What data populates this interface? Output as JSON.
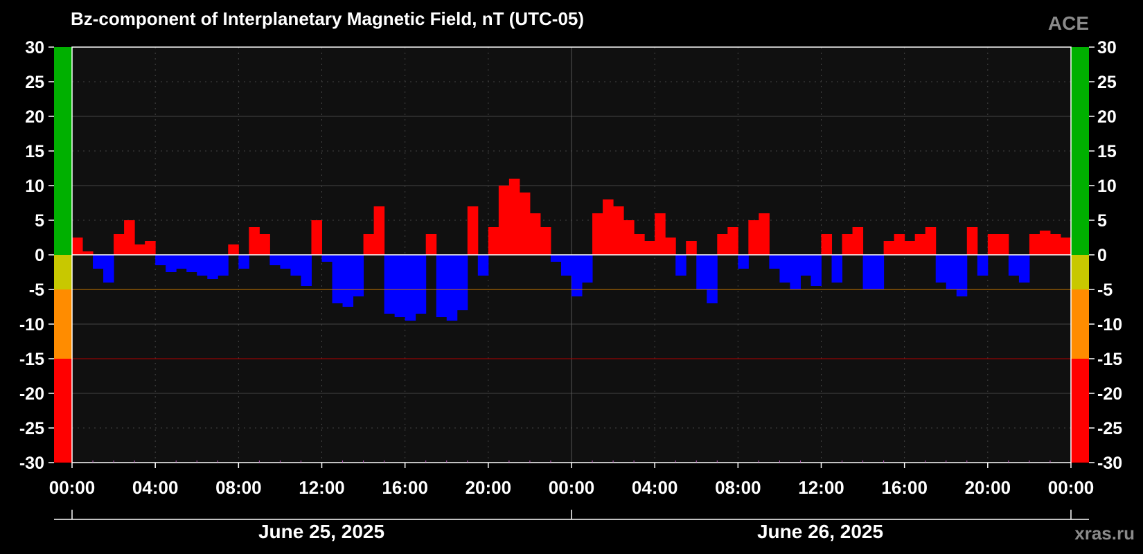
{
  "title": "Bz-component of Interplanetary Magnetic Field, nT (UTC-05)",
  "source_label": "ACE",
  "credit": "xras.ru",
  "dates": [
    "June 25, 2025",
    "June 26, 2025"
  ],
  "colors": {
    "positive": "#ff0000",
    "negative": "#0000ff",
    "plot_background": "#101010",
    "zone_green": "#00b000",
    "zone_yellow": "#c8c800",
    "zone_orange": "#ff8c00",
    "zone_red": "#ff0000"
  },
  "chart_data": {
    "type": "bar",
    "title": "Bz-component of Interplanetary Magnetic Field, nT (UTC-05)",
    "xlabel": "",
    "ylabel": "",
    "ylim": [
      -30,
      30
    ],
    "yticks": [
      30,
      25,
      20,
      15,
      10,
      5,
      0,
      -5,
      -10,
      -15,
      -20,
      -25,
      -30
    ],
    "xlim_hours": [
      0,
      48
    ],
    "xticks": [
      "00:00",
      "04:00",
      "08:00",
      "12:00",
      "16:00",
      "20:00",
      "00:00",
      "04:00",
      "08:00",
      "12:00",
      "16:00",
      "20:00",
      "00:00"
    ],
    "grid": true,
    "thresholds": [
      -5,
      -15
    ],
    "zones": [
      {
        "from": 0,
        "to": 30,
        "color": "#00b000"
      },
      {
        "from": -5,
        "to": 0,
        "color": "#c8c800"
      },
      {
        "from": -15,
        "to": -5,
        "color": "#ff8c00"
      },
      {
        "from": -30,
        "to": -15,
        "color": "#ff0000"
      }
    ],
    "x_hours": [
      0,
      0.5,
      1,
      1.5,
      2,
      2.5,
      3,
      3.5,
      4,
      4.5,
      5,
      5.5,
      6,
      6.5,
      7,
      7.5,
      8,
      8.5,
      9,
      9.5,
      10,
      10.5,
      11,
      11.5,
      12,
      12.5,
      13,
      13.5,
      14,
      14.5,
      15,
      15.5,
      16,
      16.5,
      17,
      17.5,
      18,
      18.5,
      19,
      19.5,
      20,
      20.5,
      21,
      21.5,
      22,
      22.5,
      23,
      23.5,
      24,
      24.5,
      25,
      25.5,
      26,
      26.5,
      27,
      27.5,
      28,
      28.5,
      29,
      29.5,
      30,
      30.5,
      31,
      31.5,
      32,
      32.5,
      33,
      33.5,
      34,
      34.5,
      35,
      35.5,
      36,
      36.5,
      37,
      37.5,
      38,
      38.5,
      39,
      39.5,
      40,
      40.5,
      41,
      41.5,
      42,
      42.5,
      43,
      43.5,
      44,
      44.5,
      45,
      45.5,
      46,
      46.5,
      47,
      47.5
    ],
    "values": [
      2.5,
      0.5,
      -2,
      -4,
      3,
      5,
      1.5,
      2,
      -1.5,
      -2.5,
      -2,
      -2.5,
      -3,
      -3.5,
      -3,
      1.5,
      -2,
      4,
      3,
      -1.5,
      -2,
      -3,
      -4.5,
      5,
      -1,
      -7,
      -7.5,
      -6,
      3,
      7,
      -8.5,
      -9,
      -9.5,
      -8.5,
      3,
      -9,
      -9.5,
      -8,
      7,
      -3,
      4,
      10,
      11,
      9,
      6,
      4,
      -1,
      -3,
      -6,
      -4,
      6,
      8,
      7,
      5,
      3,
      2,
      6,
      2.5,
      -3,
      2,
      -5,
      -7,
      3,
      4,
      -2,
      5,
      6,
      -2,
      -4,
      -5,
      -3,
      -4.5,
      3,
      -4,
      3,
      4,
      -5,
      -5,
      2,
      3,
      2,
      3,
      4,
      -4,
      -5,
      -6,
      4,
      -3,
      3,
      3,
      -3,
      -4,
      3,
      3.5,
      3,
      2.5
    ],
    "bar_width_hours": 0.5
  }
}
